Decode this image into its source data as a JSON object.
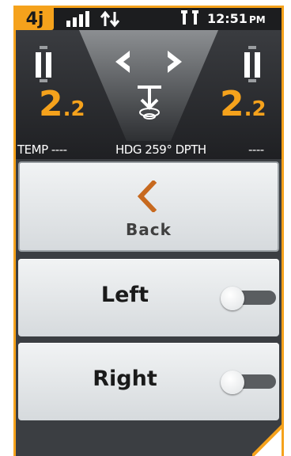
{
  "step": "4j",
  "status_bar": {
    "data_icon": "data-transfer-icon",
    "signal_icon": "signal-bars-icon",
    "antenna_icon": "gps-antenna-icon",
    "time": "12:51",
    "ampm": "PM"
  },
  "nav": {
    "left_value_main": "2",
    "left_value_sub": ".2",
    "right_value_main": "2",
    "right_value_sub": ".2",
    "readout_temp": "TEMP ----",
    "readout_hdg": "HDG 259° DPTH",
    "readout_depth": "----"
  },
  "menu": {
    "back_label": "Back",
    "items": [
      {
        "label": "Left",
        "toggle_on": false
      },
      {
        "label": "Right",
        "toggle_on": false
      }
    ]
  },
  "colors": {
    "accent": "#f5a21c",
    "header_bg": "#1c1d1f",
    "menu_bg": "#e5e8ea",
    "toggle_track": "#5a5d60"
  }
}
